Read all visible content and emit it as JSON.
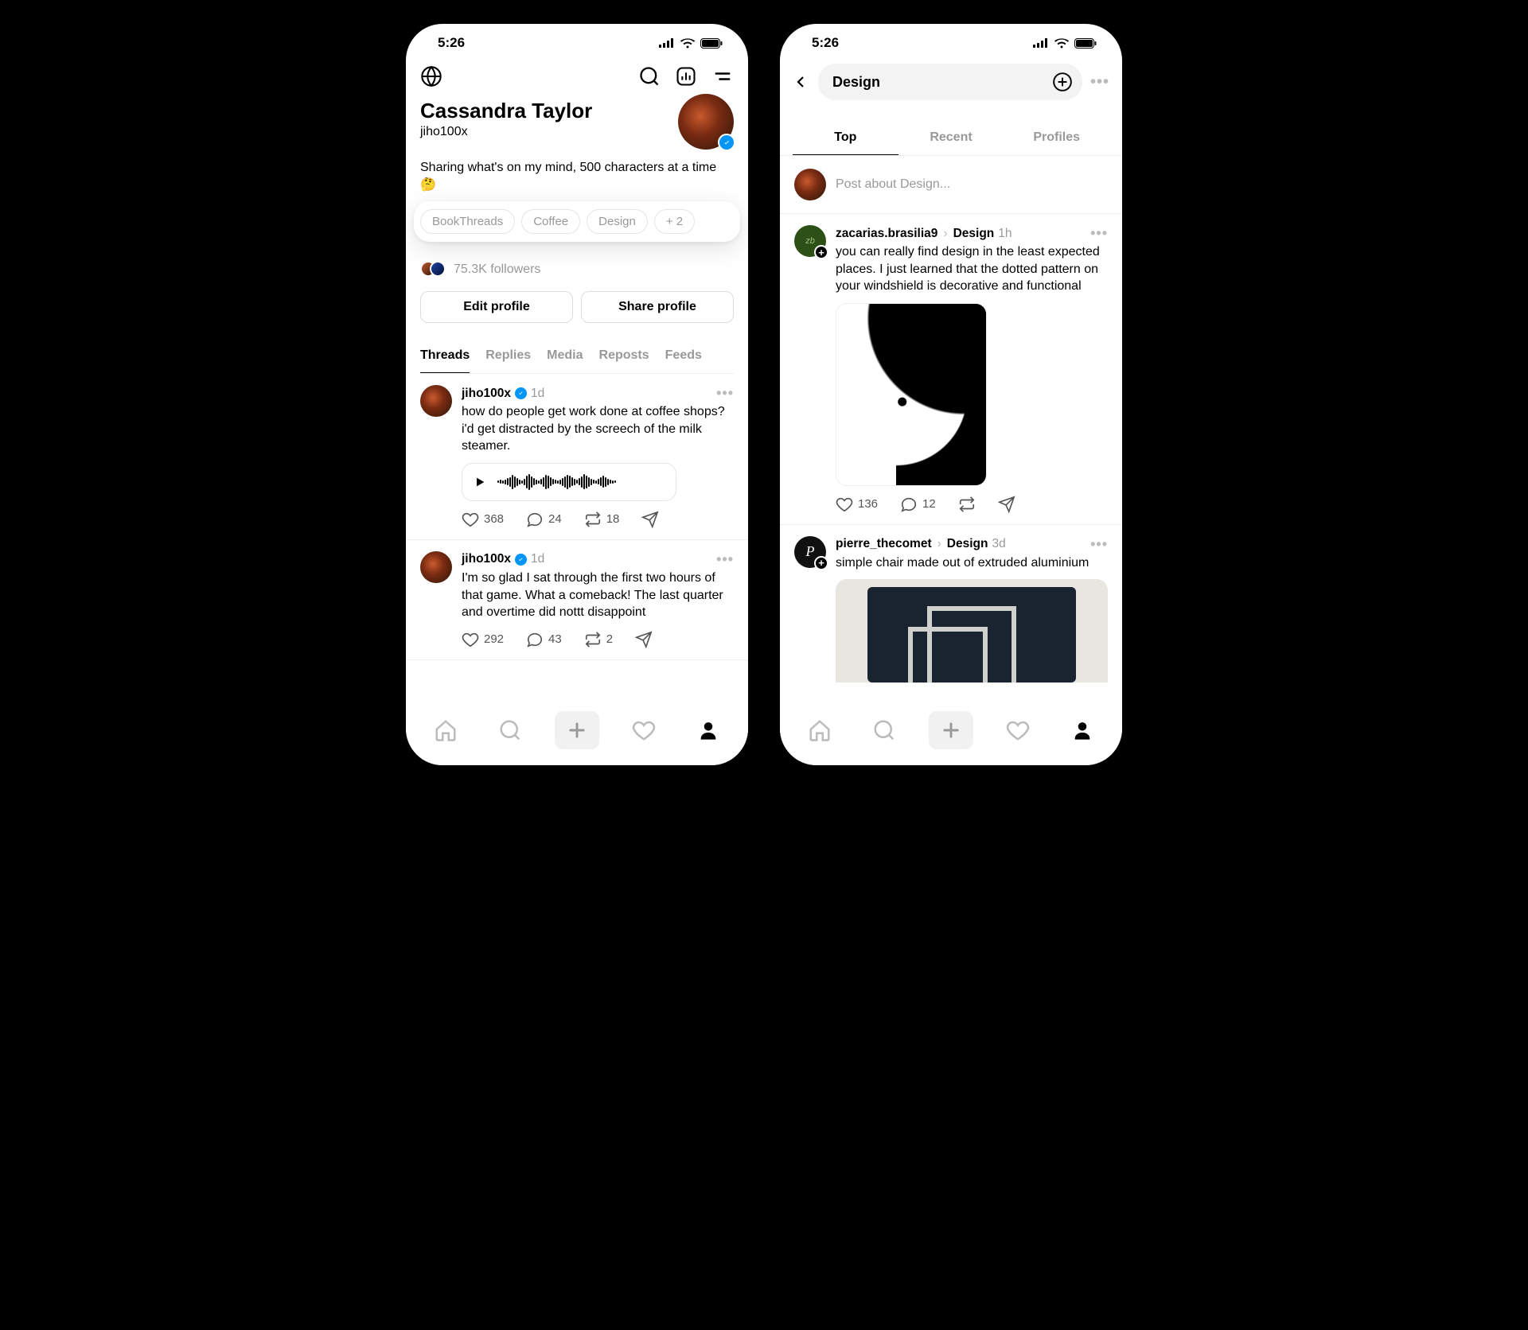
{
  "status": {
    "time": "5:26"
  },
  "left": {
    "profile": {
      "display_name": "Cassandra Taylor",
      "username": "jiho100x",
      "bio": "Sharing what's on my mind, 500 characters at a time 🤔",
      "chips": [
        "BookThreads",
        "Coffee",
        "Design",
        "+ 2"
      ],
      "followers": "75.3K followers",
      "edit_btn": "Edit profile",
      "share_btn": "Share profile"
    },
    "tabs": [
      "Threads",
      "Replies",
      "Media",
      "Reposts",
      "Feeds"
    ],
    "posts": [
      {
        "user": "jiho100x",
        "time": "1d",
        "text": "how do people get work done at coffee shops? i'd get distracted by the screech of the milk steamer.",
        "has_voice": true,
        "likes": "368",
        "replies": "24",
        "reposts": "18"
      },
      {
        "user": "jiho100x",
        "time": "1d",
        "text": "I'm so glad I sat through the first two hours of that game. What a comeback! The last quarter and overtime did nottt disappoint",
        "has_voice": false,
        "likes": "292",
        "replies": "43",
        "reposts": "2"
      }
    ]
  },
  "right": {
    "search_term": "Design",
    "tabs": [
      "Top",
      "Recent",
      "Profiles"
    ],
    "compose_placeholder": "Post about Design...",
    "posts": [
      {
        "user": "zacarias.brasilia9",
        "topic": "Design",
        "time": "1h",
        "text": "you can really find design in the least expected places. I just learned that the dotted pattern on your windshield is decorative and functional",
        "likes": "136",
        "replies": "12"
      },
      {
        "user": "pierre_thecomet",
        "topic": "Design",
        "time": "3d",
        "text": "simple chair made out of extruded aluminium"
      }
    ]
  }
}
